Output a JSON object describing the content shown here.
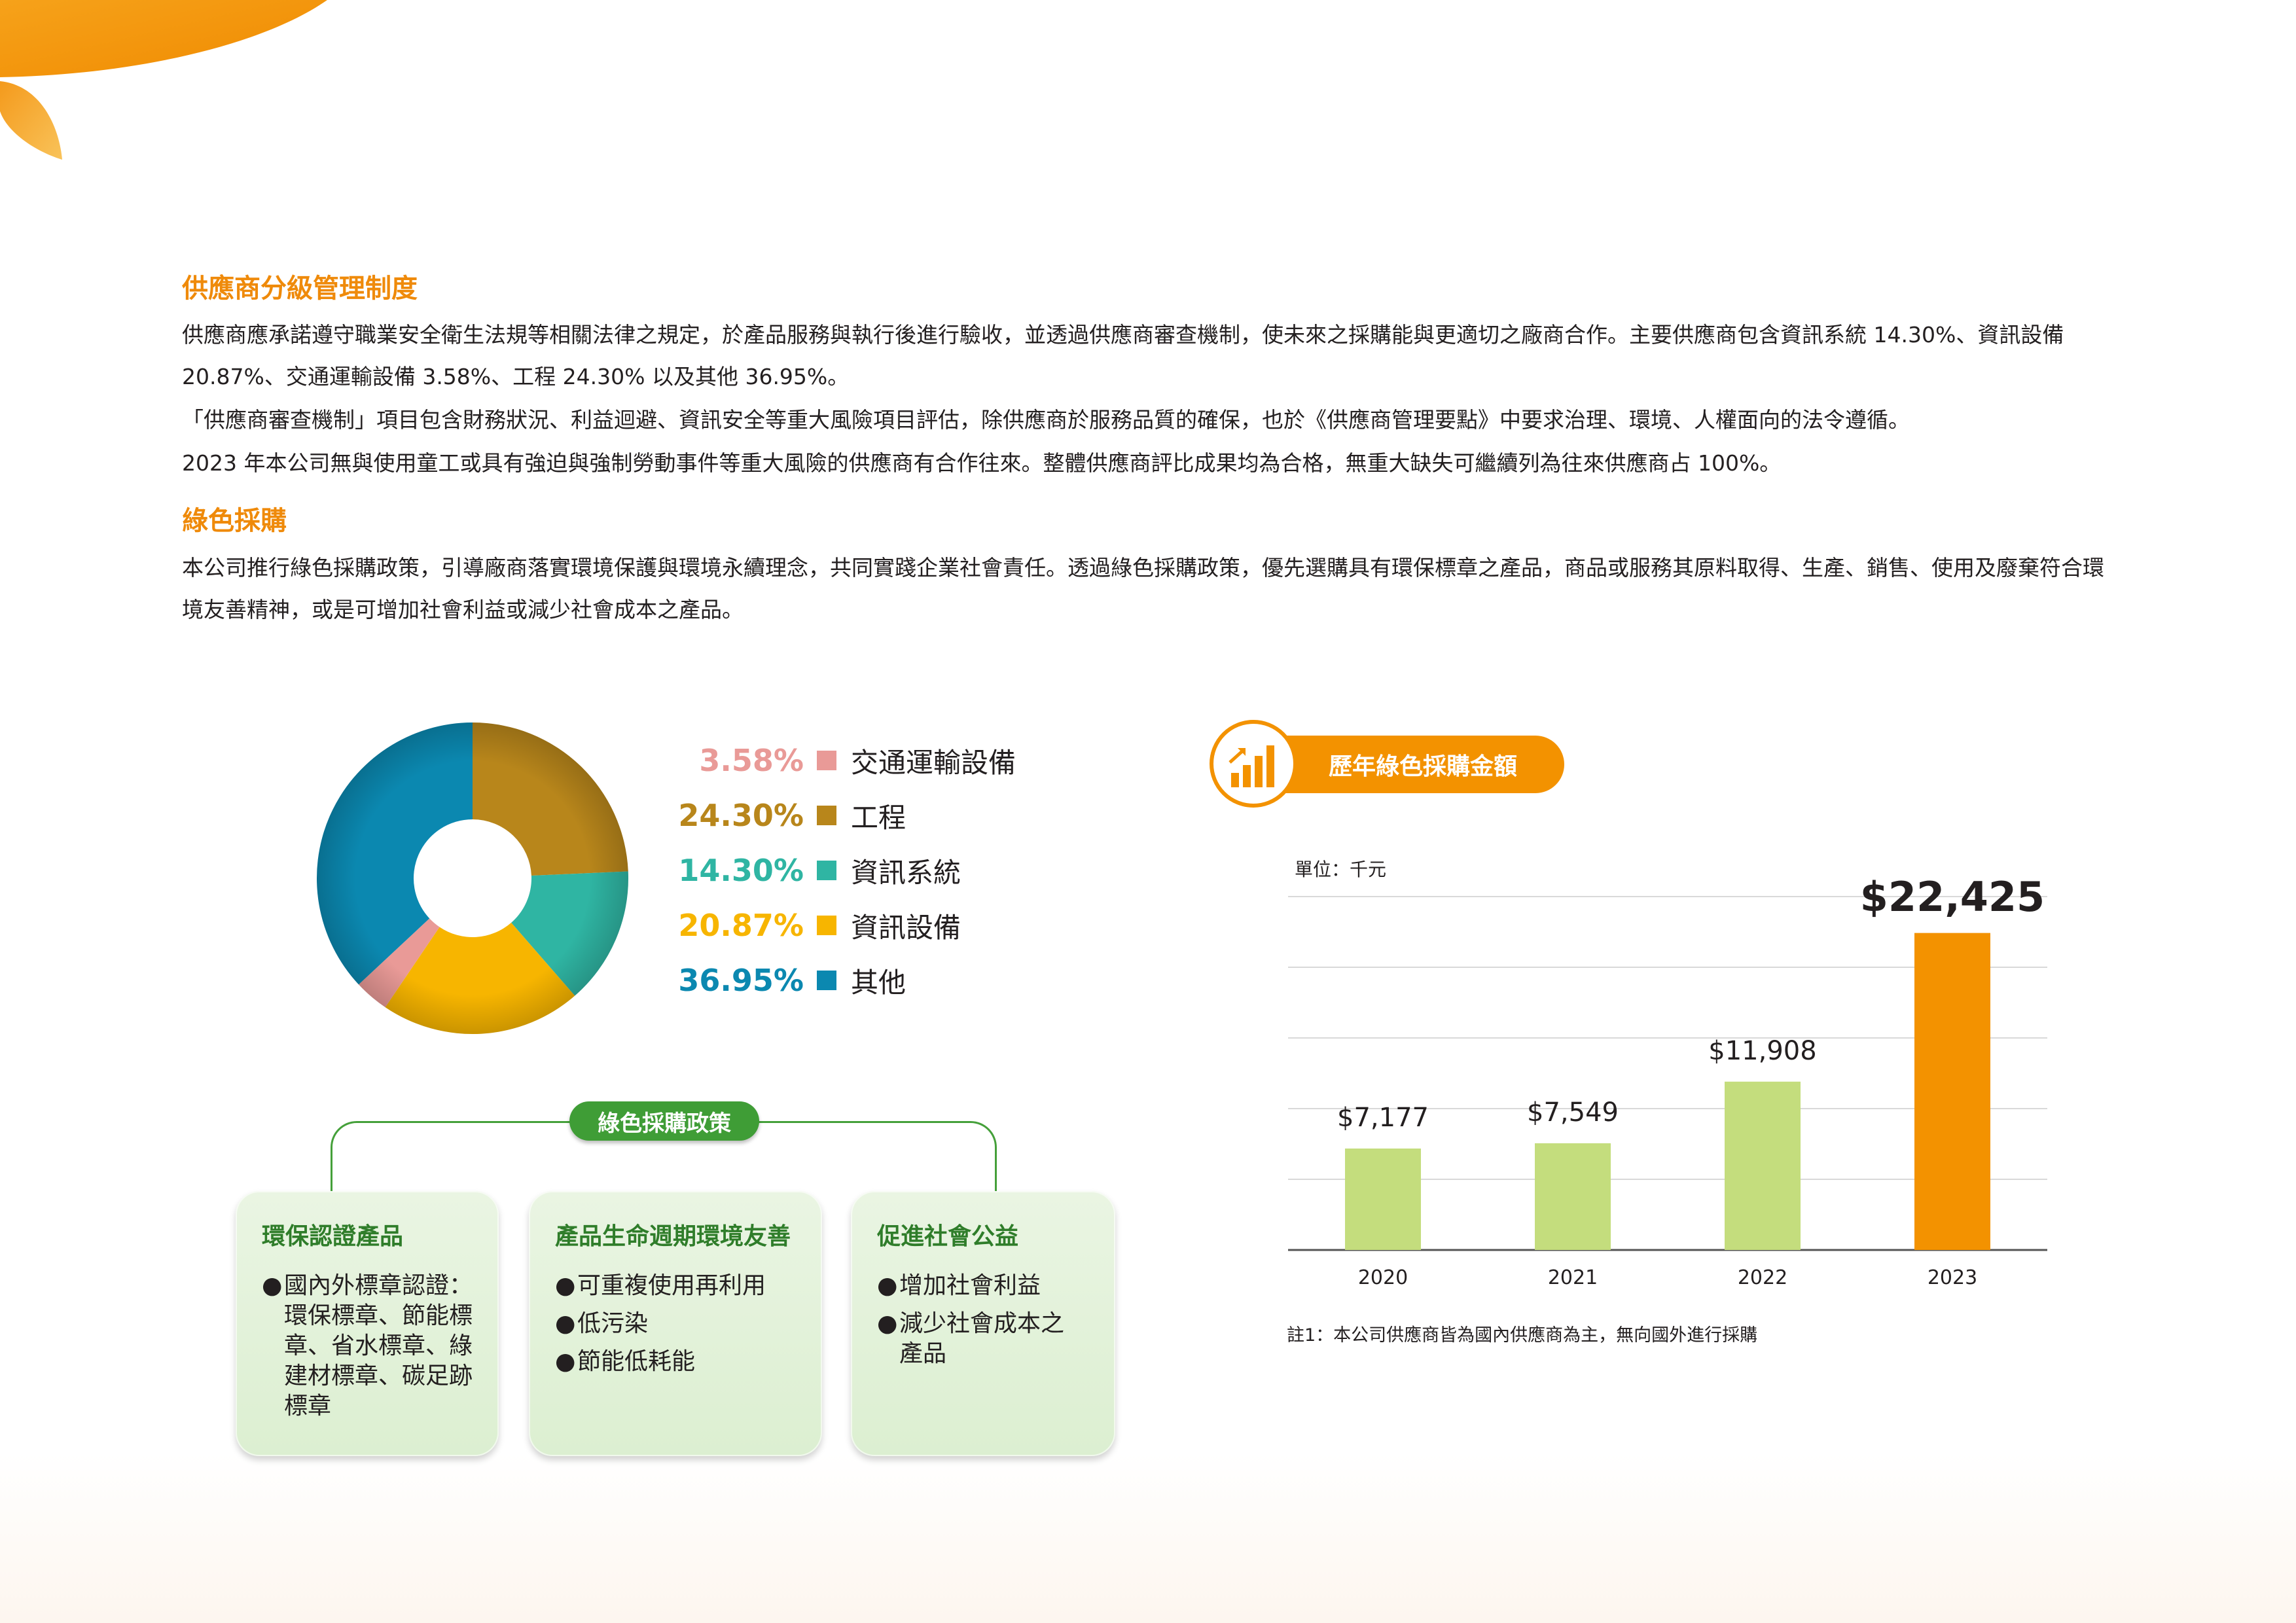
{
  "section1": {
    "title": "供應商分級管理制度",
    "p1": "供應商應承諾遵守職業安全衛生法規等相關法律之規定，於產品服務與執行後進行驗收，並透過供應商審查機制，使未來之採購能與更適切之廠商合作。主要供應商包含資訊系統 14.30%、資訊設備 20.87%、交通運輸設備 3.58%、工程 24.30% 以及其他 36.95%。",
    "p2": "「供應商審查機制」項目包含財務狀況、利益迴避、資訊安全等重大風險項目評估，除供應商於服務品質的確保，也於《供應商管理要點》中要求治理、環境、人權面向的法令遵循。",
    "p3": "2023 年本公司無與使用童工或具有強迫與強制勞動事件等重大風險的供應商有合作往來。整體供應商評比成果均為合格，無重大缺失可繼續列為往來供應商占 100%。"
  },
  "section2": {
    "title": "綠色採購",
    "p1": "本公司推行綠色採購政策，引導廠商落實環境保護與環境永續理念，共同實踐企業社會責任。透過綠色採購政策，優先選購具有環保標章之產品，商品或服務其原料取得、生產、銷售、使用及廢棄符合環境友善精神，或是可增加社會利益或減少社會成本之產品。"
  },
  "chart_data": [
    {
      "type": "pie",
      "slices": [
        {
          "label": "交通運輸設備",
          "value": 3.58,
          "display": "3.58%",
          "color": "#e99a97"
        },
        {
          "label": "工程",
          "value": 24.3,
          "display": "24.30%",
          "color": "#b8861b"
        },
        {
          "label": "資訊系統",
          "value": 14.3,
          "display": "14.30%",
          "color": "#2fb5a3"
        },
        {
          "label": "資訊設備",
          "value": 20.87,
          "display": "20.87%",
          "color": "#f7b500"
        },
        {
          "label": "其他",
          "value": 36.95,
          "display": "36.95%",
          "color": "#0b88b0"
        }
      ],
      "draw_order": [
        "工程",
        "資訊系統",
        "資訊設備",
        "交通運輸設備",
        "其他"
      ],
      "donut": true
    },
    {
      "type": "bar",
      "title": "歷年綠色採購金額",
      "unit_label": "單位：千元",
      "categories": [
        "2020",
        "2021",
        "2022",
        "2023"
      ],
      "values": [
        7177,
        7549,
        11908,
        22425
      ],
      "value_labels": [
        "$7,177",
        "$7,549",
        "$11,908",
        "$22,425"
      ],
      "colors": [
        "#c4dd7d",
        "#c4dd7d",
        "#c4dd7d",
        "#f39200"
      ],
      "ylim": [
        0,
        25000
      ],
      "gridlines": [
        5000,
        10000,
        15000,
        20000,
        25000
      ],
      "note": "註1：本公司供應商皆為國內供應商為主，無向國外進行採購"
    }
  ],
  "policy": {
    "title": "綠色採購政策",
    "boxes": [
      {
        "title": "環保認證產品",
        "items": [
          "國內外標章認證：環保標章、節能標章、省水標章、綠建材標章、碳足跡標章"
        ]
      },
      {
        "title": "產品生命週期環境友善",
        "items": [
          "可重複使用再利用",
          "低污染",
          "節能低耗能"
        ]
      },
      {
        "title": "促進社會公益",
        "items": [
          "增加社會利益",
          "減少社會成本之產品"
        ]
      }
    ],
    "bullet": "●"
  },
  "colors": {
    "accent_orange": "#ef8a0a",
    "policy_green": "#3f9d36"
  }
}
